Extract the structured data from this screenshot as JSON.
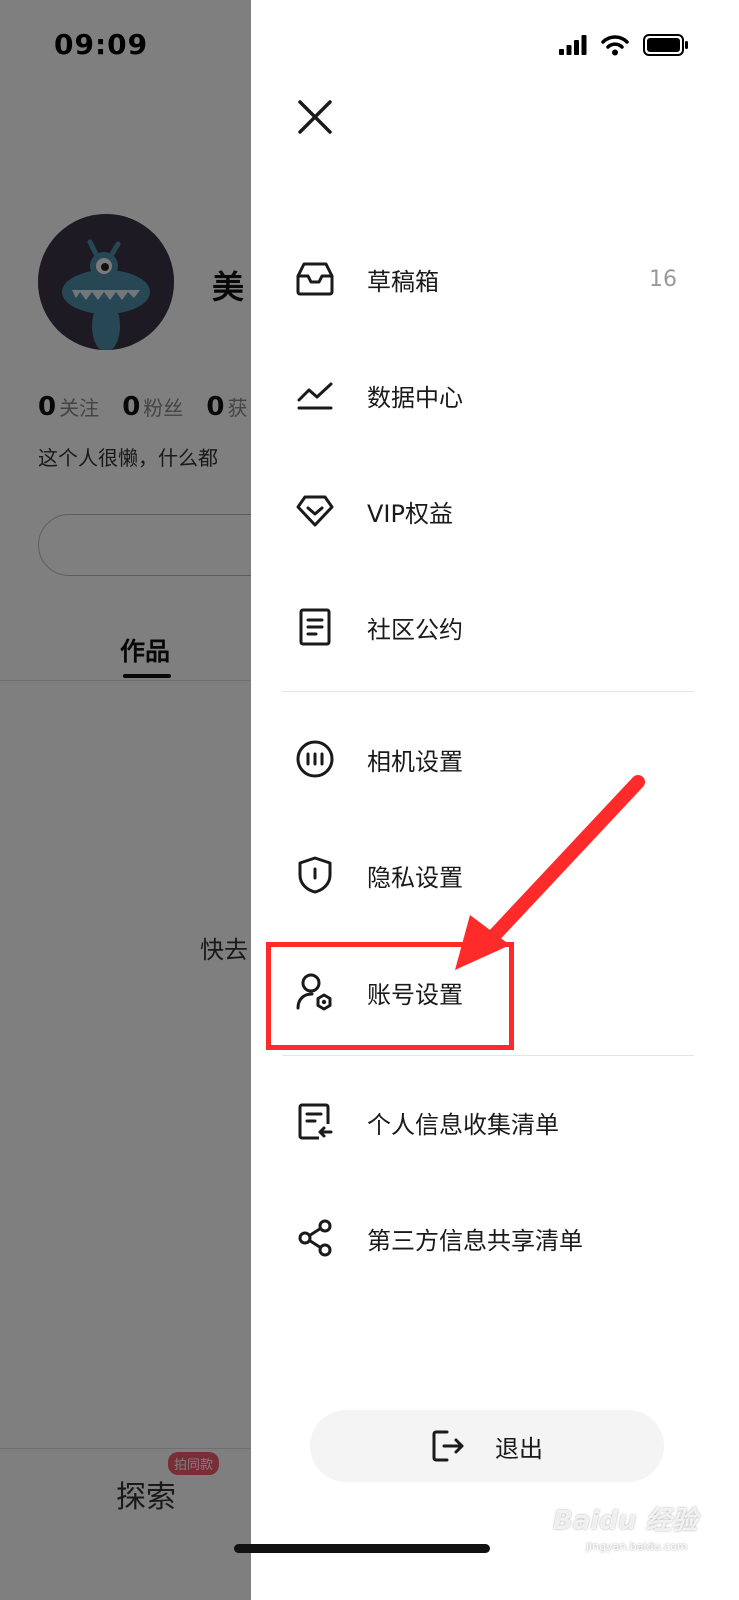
{
  "status_bar": {
    "time": "09:09"
  },
  "profile": {
    "username": "美",
    "stats": [
      {
        "count": "0",
        "label": "关注"
      },
      {
        "count": "0",
        "label": "粉丝"
      },
      {
        "count": "0",
        "label": "获"
      }
    ],
    "bio": "这个人很懒，什么都",
    "tab_works": "作品",
    "empty_hint": "快去",
    "bottom_nav": {
      "explore": "探索",
      "explore_badge": "拍同款"
    }
  },
  "drawer": {
    "menu": [
      {
        "label": "草稿箱",
        "count": "16",
        "icon": "inbox-icon"
      },
      {
        "label": "数据中心",
        "icon": "chart-line-icon"
      },
      {
        "label": "VIP权益",
        "icon": "diamond-icon"
      },
      {
        "label": "社区公约",
        "icon": "document-icon"
      },
      {
        "label": "相机设置",
        "icon": "camera-dial-icon"
      },
      {
        "label": "隐私设置",
        "icon": "shield-icon"
      },
      {
        "label": "账号设置",
        "icon": "user-gear-icon"
      },
      {
        "label": "个人信息收集清单",
        "icon": "list-return-icon"
      },
      {
        "label": "第三方信息共享清单",
        "icon": "share-icon"
      }
    ],
    "logout_label": "退出"
  },
  "annotation": {
    "highlight_color": "#ff2a2a",
    "target": "账号设置"
  },
  "watermark": {
    "brand": "Baidu 经验",
    "url": "jingyan.baidu.com"
  }
}
